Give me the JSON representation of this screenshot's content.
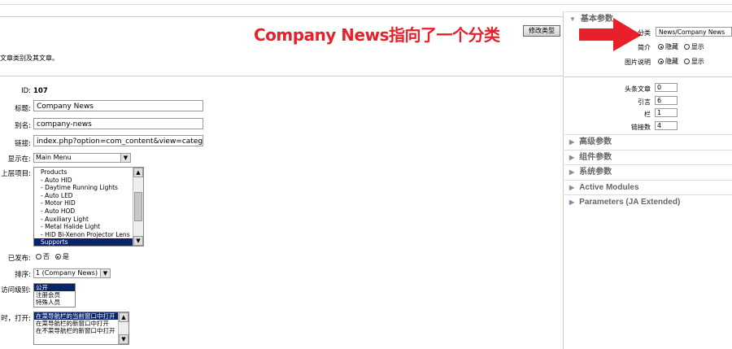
{
  "annotation": {
    "text": "Company News指向了一个分类",
    "color": "#e8202a"
  },
  "toolbar": {
    "change_type_label": "修改类型"
  },
  "header": {
    "subtitle": "文章类别及其文章。"
  },
  "form": {
    "id_label": "ID:",
    "id_value": "107",
    "title_label": "标题:",
    "title_value": "Company News",
    "alias_label": "别名:",
    "alias_value": "company-news",
    "link_label": "链接:",
    "link_value": "index.php?option=com_content&view=category&layout=blog&id=",
    "display_in_label": "显示在:",
    "display_in_value": "Main Menu",
    "parent_label": "上层项目:",
    "parent_items": [
      "Products",
      " - Auto HID",
      " - Daytime Running Lights",
      " - Auto LED",
      " - Motor HID",
      " - Auto HOD",
      " - Auxiliary Light",
      " - Metal Halide Light",
      " - HID Bi-Xenon Projector Lens",
      "Supports"
    ],
    "parent_selected": "Supports",
    "published_label": "已发布:",
    "published_no": "否",
    "published_yes": "是",
    "order_label": "排序:",
    "order_value": "1 (Company News)",
    "access_label": "访问级别:",
    "access_items": [
      "公开",
      "注册会员",
      "特殊人员"
    ],
    "access_selected": "公开",
    "onclick_label": "时，打开:",
    "onclick_items": [
      "在菜导航栏的当前窗口中打开",
      "在菜导航栏的新窗口中打开",
      "在不菜导航栏的新窗口中打开"
    ],
    "onclick_selected": "在菜导航栏的当前窗口中打开"
  },
  "right_panel": {
    "basic_header": "基本参数",
    "category_label": "分类",
    "category_value": "News/Company News",
    "intro_label": "简介",
    "intro_hide": "隐藏",
    "intro_show": "显示",
    "image_label": "图片说明",
    "image_hide": "隐藏",
    "image_show": "显示",
    "leading_label": "头条文章",
    "leading_value": "0",
    "intro_count_label": "引言",
    "intro_count_value": "6",
    "columns_label": "栏",
    "columns_value": "1",
    "links_label": "链接数",
    "links_value": "4",
    "sections": [
      "高级参数",
      "组件参数",
      "系统参数",
      "Active Modules",
      "Parameters (JA Extended)"
    ]
  },
  "colors": {
    "selection": "#0a246a",
    "arrow": "#e8202a",
    "header_text": "#666666"
  }
}
